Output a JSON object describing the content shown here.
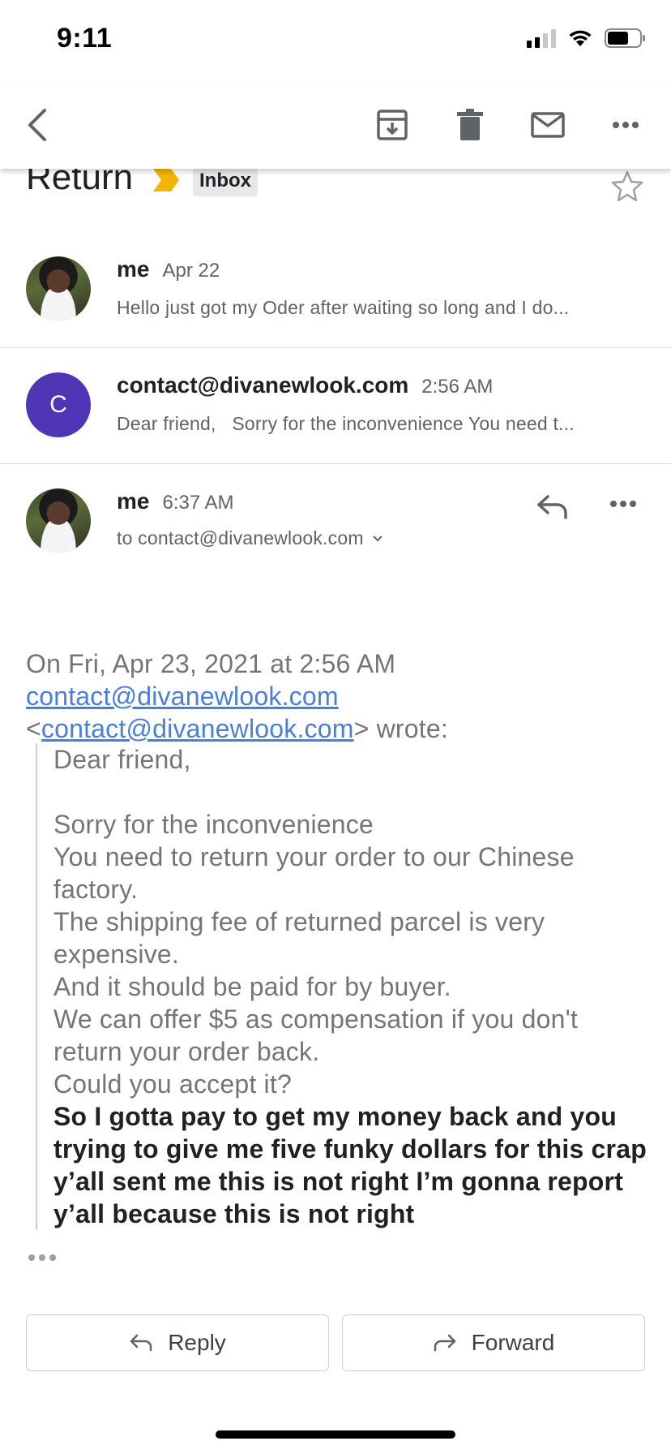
{
  "status_bar": {
    "time": "9:11"
  },
  "subject": {
    "title": "Return",
    "label": "Inbox"
  },
  "thread": [
    {
      "sender": "me",
      "time": "Apr 22",
      "snippet": "Hello just got my Oder after waiting so long and I do..."
    },
    {
      "sender": "contact@divanewlook.com",
      "avatar_letter": "C",
      "time": "2:56 AM",
      "snippet": "Dear friend,   Sorry for the inconvenience You need t..."
    }
  ],
  "expanded": {
    "sender": "me",
    "time": "6:37 AM",
    "recipient": "to contact@divanewlook.com"
  },
  "body": {
    "intro": "On Fri, Apr 23, 2021 at 2:56 AM",
    "link1": "contact@divanewlook.com",
    "lt": "<",
    "link2": "contact@divanewlook.com",
    "wrote": "> wrote:",
    "quote_lines": [
      "Dear friend,",
      "Sorry for the inconvenience",
      "You need to return your order to our Chinese factory.",
      "The shipping fee of returned parcel is very expensive.",
      "And it should be paid for by buyer.",
      "We can offer $5 as compensation if you don't return your order back.",
      "Could you accept it?"
    ],
    "reply_text": "So I gotta pay to get my money back and you trying to give me five funky dollars for this crap y’all sent me this is not right I’m gonna report y’all because this is not right"
  },
  "actions": {
    "reply_label": "Reply",
    "forward_label": "Forward"
  },
  "colors": {
    "link": "#4a7fd8",
    "avatar_c": "#4e35b5",
    "importance": "#f4b400"
  }
}
